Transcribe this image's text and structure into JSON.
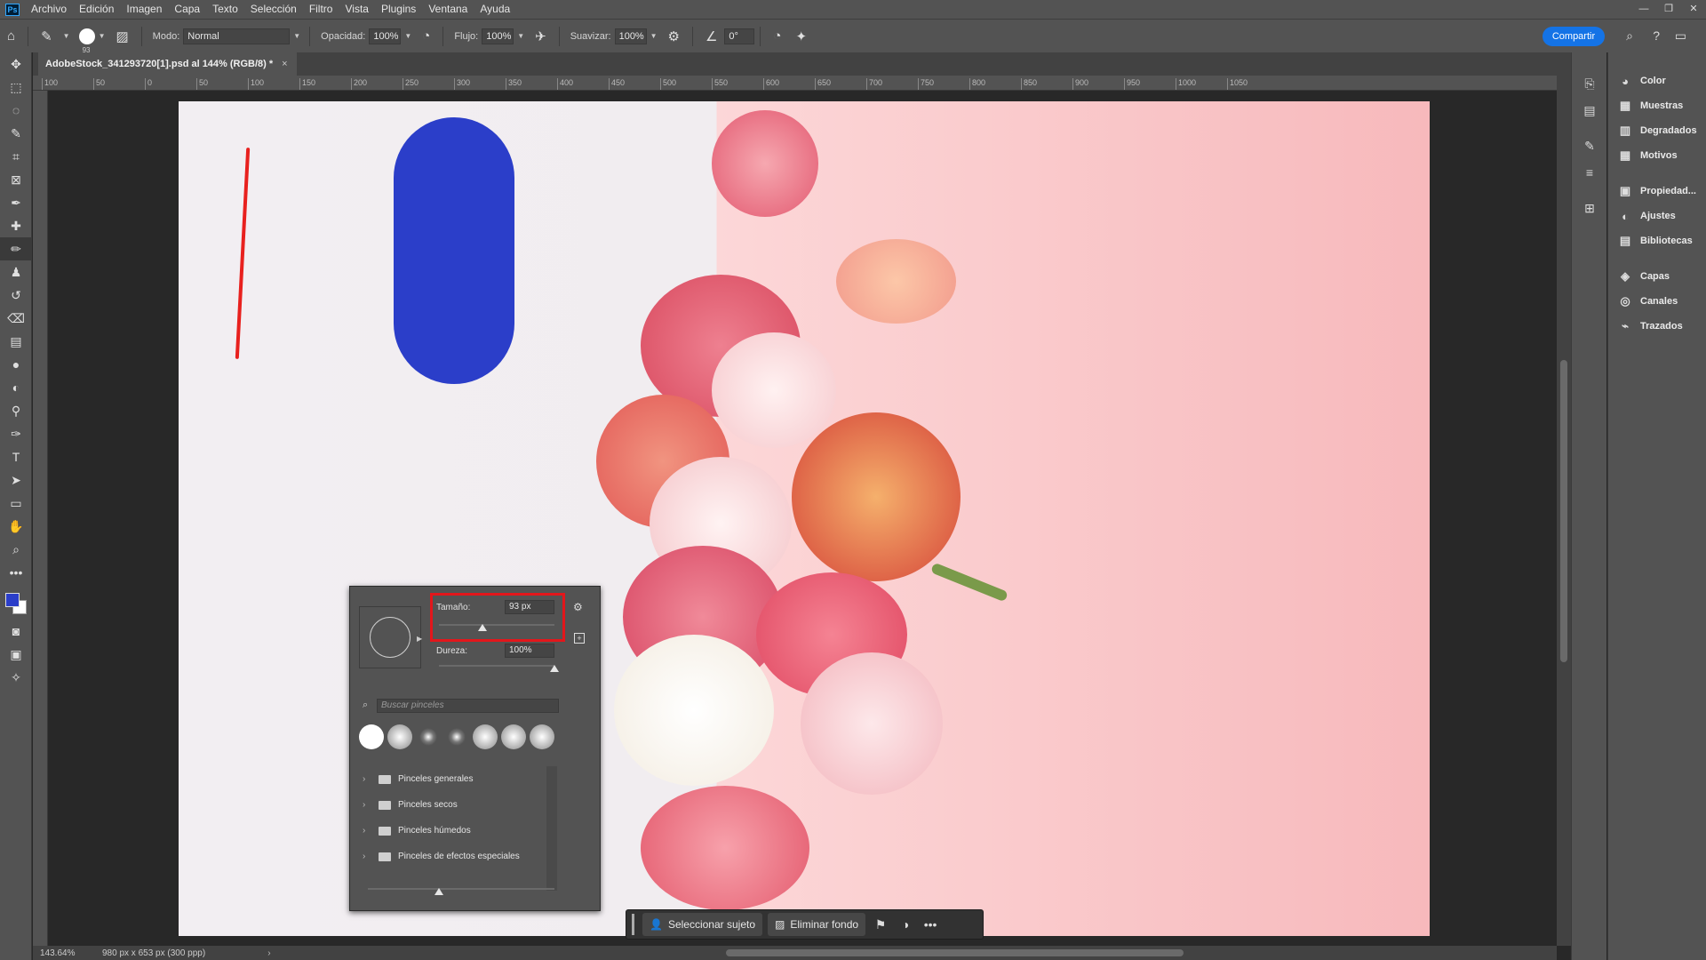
{
  "app": {
    "logo": "Ps"
  },
  "menu": [
    "Archivo",
    "Edición",
    "Imagen",
    "Capa",
    "Texto",
    "Selección",
    "Filtro",
    "Vista",
    "Plugins",
    "Ventana",
    "Ayuda"
  ],
  "options": {
    "brush_size": "93",
    "mode_label": "Modo:",
    "mode_value": "Normal",
    "opacity_label": "Opacidad:",
    "opacity_value": "100%",
    "flow_label": "Flujo:",
    "flow_value": "100%",
    "smooth_label": "Suavizar:",
    "smooth_value": "100%",
    "angle_value": "0°",
    "share_label": "Compartir"
  },
  "document": {
    "tab_title": "AdobeStock_341293720[1].psd al 144% (RGB/8) *",
    "close": "×"
  },
  "ruler_ticks": [
    "100",
    "50",
    "0",
    "50",
    "100",
    "150",
    "200",
    "250",
    "300",
    "350",
    "400",
    "450",
    "500",
    "550",
    "600",
    "650",
    "700",
    "750",
    "800",
    "850",
    "900",
    "950",
    "1000",
    "1050"
  ],
  "brush_panel": {
    "size_label": "Tamaño:",
    "size_value": "93 px",
    "size_fraction": 0.38,
    "hardness_label": "Dureza:",
    "hardness_value": "100%",
    "hardness_fraction": 1.0,
    "search_placeholder": "Buscar pinceles",
    "folders": [
      "Pinceles generales",
      "Pinceles secos",
      "Pinceles húmedos",
      "Pinceles de efectos especiales"
    ]
  },
  "context_bar": {
    "select_subject": "Seleccionar sujeto",
    "remove_bg": "Eliminar fondo"
  },
  "status": {
    "zoom": "143.64%",
    "doc_info": "980 px x 653 px (300 ppp)"
  },
  "panels": {
    "group1": [
      "Color",
      "Muestras",
      "Degradados",
      "Motivos"
    ],
    "group2": [
      "Propiedad...",
      "Ajustes",
      "Bibliotecas"
    ],
    "group3": [
      "Capas",
      "Canales",
      "Trazados"
    ]
  },
  "colors": {
    "foreground": "#2b3ec9",
    "background": "#ffffff",
    "highlight_box": "#e3161b",
    "accent": "#1473e6"
  }
}
